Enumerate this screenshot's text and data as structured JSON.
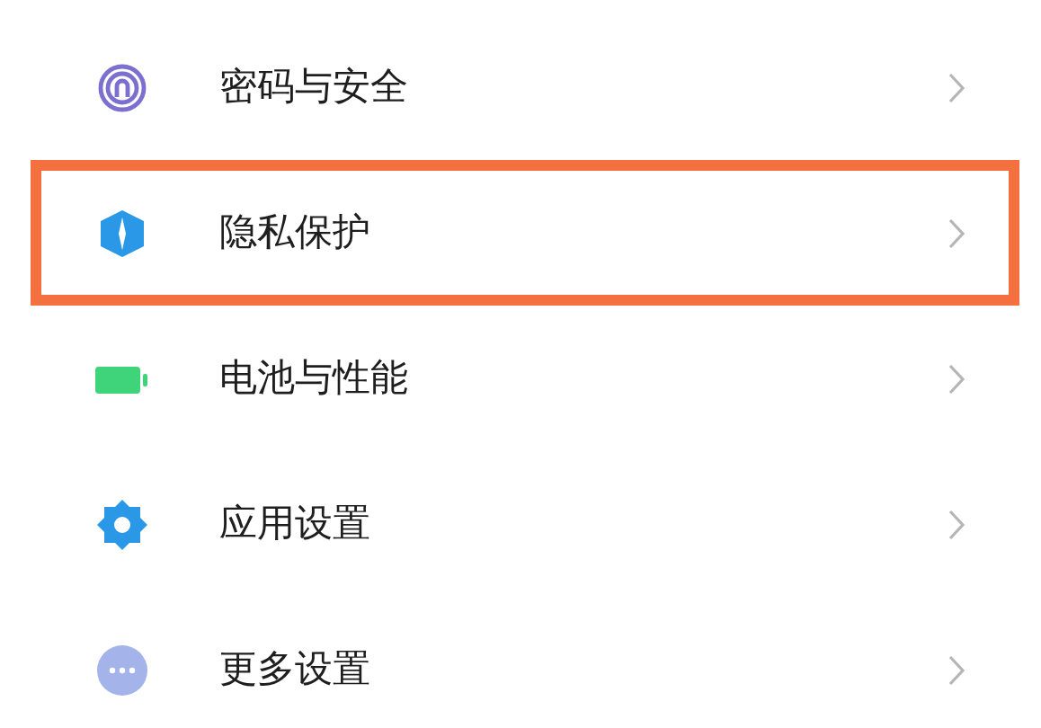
{
  "settings_list": [
    {
      "kind": "fingerprint",
      "label": "密码与安全",
      "highlighted": false
    },
    {
      "kind": "privacy",
      "label": "隐私保护",
      "highlighted": true
    },
    {
      "kind": "battery",
      "label": "电池与性能",
      "highlighted": false
    },
    {
      "kind": "gear",
      "label": "应用设置",
      "highlighted": false
    },
    {
      "kind": "more",
      "label": "更多设置",
      "highlighted": false
    }
  ]
}
